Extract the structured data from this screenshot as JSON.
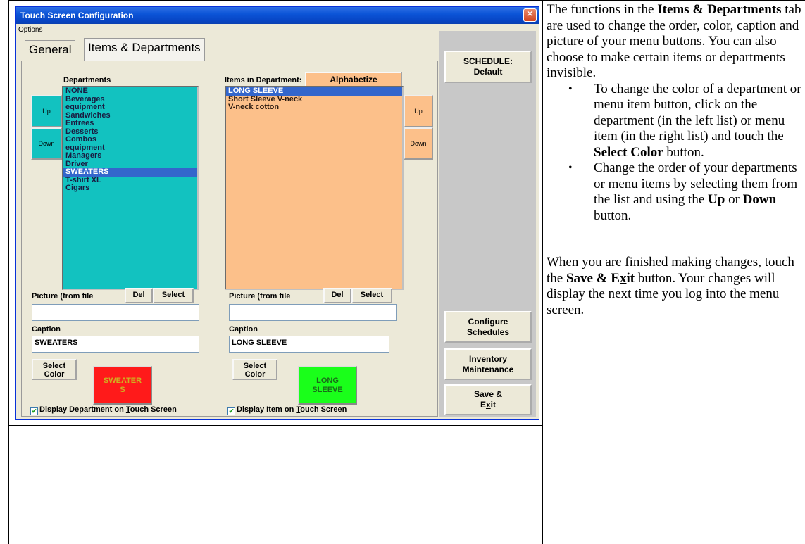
{
  "window": {
    "title": "Touch Screen Configuration",
    "close_glyph": "✕",
    "menu_options": "Options",
    "tabs": [
      {
        "label": "General",
        "active": false
      },
      {
        "label": "Items & Departments",
        "active": true
      }
    ]
  },
  "departments": {
    "header": "Departments",
    "up_label": "Up",
    "down_label": "Down",
    "items": [
      "NONE",
      "Beverages",
      "equipment",
      "Sandwiches",
      "Entrees",
      "Desserts",
      "Combos",
      "equipment",
      "Managers",
      "Driver",
      "SWEATERS",
      "T-shirt XL",
      "Cigars"
    ],
    "selected_index": 10,
    "picture_label": "Picture (from file",
    "del_label": "Del",
    "select_label": "Select",
    "picture_value": "",
    "caption_label": "Caption",
    "caption_value": "SWEATERS",
    "select_color_line1": "Select",
    "select_color_line2": "Color",
    "preview_line1": "SWEATER",
    "preview_line2": "S",
    "preview_color": "#ff1a1a",
    "preview_text_color": "#d0b020",
    "display_label_pre": "Display Department on ",
    "display_label_u": "T",
    "display_label_post": "ouch Screen",
    "display_checked": true,
    "list_color": "#12c2c0"
  },
  "items": {
    "header": "Items in Department:",
    "alphabetize_label": "Alphabetize",
    "up_label": "Up",
    "down_label": "Down",
    "items": [
      "LONG SLEEVE",
      "Short Sleeve V-neck",
      "V-neck cotton"
    ],
    "selected_index": 0,
    "picture_label": "Picture (from file",
    "del_label": "Del",
    "select_label": "Select",
    "picture_value": "",
    "caption_label": "Caption",
    "caption_value": "LONG SLEEVE",
    "select_color_line1": "Select",
    "select_color_line2": "Color",
    "preview_line1": "LONG",
    "preview_line2": "SLEEVE",
    "preview_color": "#1aff1a",
    "preview_text_color": "#1a6a1a",
    "display_label_pre": "Display Item on ",
    "display_label_u": "T",
    "display_label_post": "ouch Screen",
    "display_checked": true,
    "list_color": "#fcc08a"
  },
  "right_buttons": {
    "schedule_line1": "SCHEDULE:",
    "schedule_line2": "Default",
    "configure_line1": "Configure",
    "configure_line2": "Schedules",
    "inventory_line1": "Inventory",
    "inventory_line2": "Maintenance",
    "save_line1": "Save &",
    "save_line2_pre": "E",
    "save_line2_u": "x",
    "save_line2_post": "it"
  },
  "doc_text": {
    "intro_pre": "The functions in the ",
    "intro_bold": "Items & Departments",
    "intro_post": " tab are used to change the order, color, caption and picture of your menu buttons.  You can also choose to make certain items or departments invisible.",
    "bullet_glyph": "•",
    "bullet1_pre": "To change the color of a department or menu item button, click on the department (in the left list) or menu item (in the right list) and touch the ",
    "bullet1_bold": "Select Color",
    "bullet1_post": " button.",
    "bullet2_pre": "Change the order of your departments or menu items by selecting them from the list and using the ",
    "bullet2_bold1": "Up",
    "bullet2_mid": " or ",
    "bullet2_bold2": "Down",
    "bullet2_post": " button.",
    "outro_pre": "When you are finished making changes, touch the ",
    "outro_bold_pre": "Save & E",
    "outro_bold_u": "x",
    "outro_bold_post": "it",
    "outro_post": " button.  Your changes will display the next time you log into the menu screen."
  }
}
